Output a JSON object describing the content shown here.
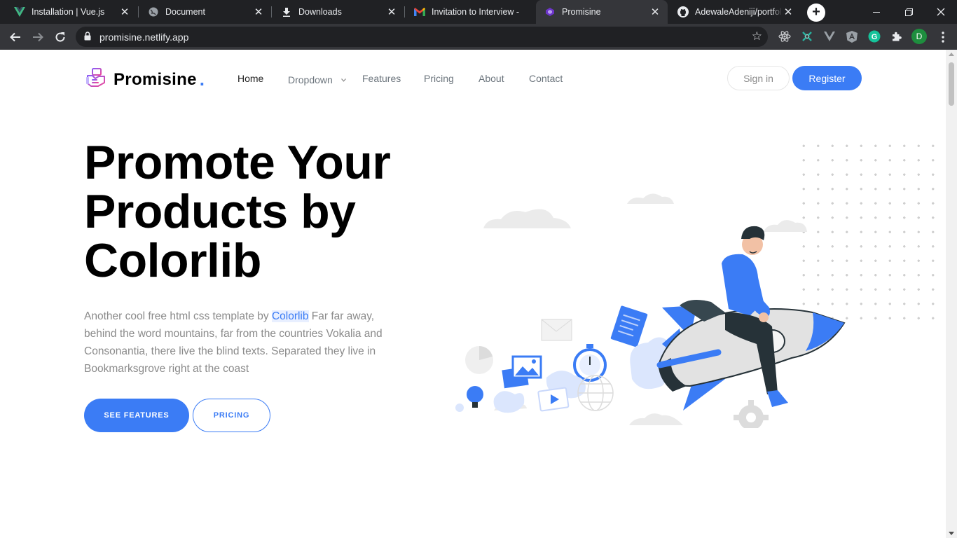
{
  "browser": {
    "tabs": [
      {
        "title": "Installation | Vue.js",
        "icon": "vue-icon"
      },
      {
        "title": "Document",
        "icon": "globe-icon"
      },
      {
        "title": "Downloads",
        "icon": "download-icon"
      },
      {
        "title": "Invitation to Interview -",
        "icon": "gmail-icon"
      },
      {
        "title": "Promisine",
        "icon": "promisine-icon",
        "active": true
      },
      {
        "title": "AdewaleAdeniji/portfoli",
        "icon": "github-icon"
      }
    ],
    "url": "promisine.netlify.app",
    "profile_initial": "D",
    "extensions": [
      "react-devtools-icon",
      "extension-icon",
      "vue-devtools-icon",
      "angular-icon",
      "grammarly-icon",
      "puzzle-icon"
    ]
  },
  "site": {
    "brand": "Promisine",
    "brand_dot": ".",
    "nav": {
      "home": "Home",
      "dropdown": "Dropdown",
      "features": "Features",
      "pricing": "Pricing",
      "about": "About",
      "contact": "Contact"
    },
    "auth": {
      "signin": "Sign in",
      "register": "Register"
    },
    "hero": {
      "title_line1": "Promote Your",
      "title_line2": "Products by",
      "title_line3": "Colorlib",
      "text_before": "Another cool free html css template by ",
      "text_link": "Colorlib",
      "text_after": " Far far away, behind the word mountains, far from the countries Vokalia and Consonantia, there live the blind texts. Separated they live in Bookmarksgrove right at the coast",
      "cta_primary": "SEE FEATURES",
      "cta_secondary": "PRICING"
    }
  },
  "colors": {
    "accent": "#3b7cf5",
    "chrome_dark": "#202124",
    "chrome_tab": "#35363a"
  }
}
